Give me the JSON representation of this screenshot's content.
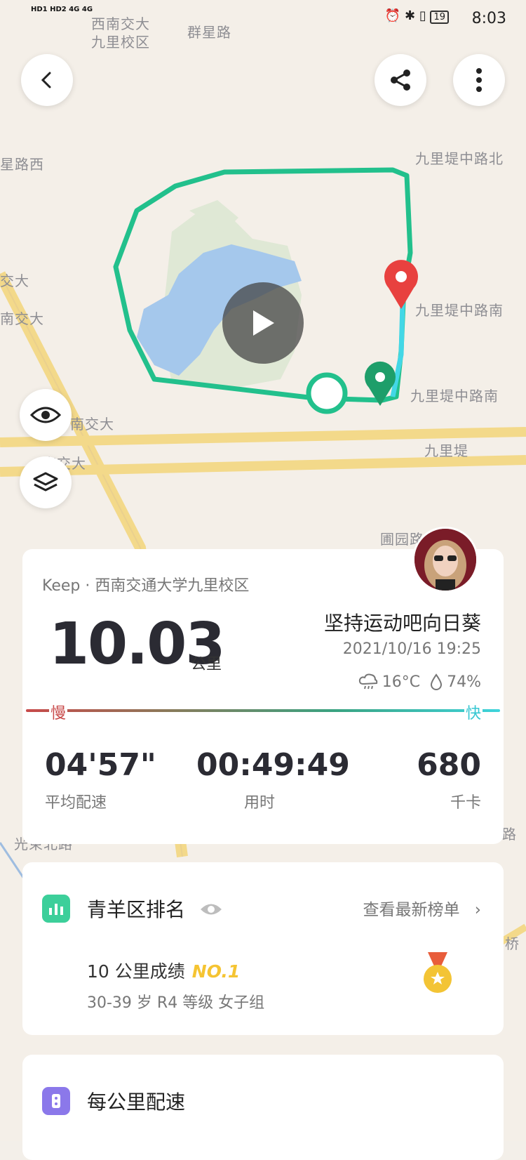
{
  "status_bar": {
    "left_indicators": "HD1 HD2 4G 4G",
    "time": "8:03",
    "battery": "19"
  },
  "map": {
    "labels": [
      "西南交大",
      "九里校区",
      "群星路",
      "九里堤中路北",
      "星路西",
      "交大",
      "南交大",
      "九里堤中路南",
      "九里堤中路南",
      "南交大",
      "南交大",
      "九里堤",
      "圃园路",
      "光束北路",
      "路",
      "桥"
    ],
    "start_color": "#1e9e6a",
    "end_color": "#e8413f",
    "route_color": "#22c08c"
  },
  "summary": {
    "source": "Keep · 西南交通大学九里校区",
    "distance": "10.03",
    "distance_unit": "公里",
    "username": "坚持运动吧向日葵",
    "datetime": "2021/10/16 19:25",
    "temperature": "16°C",
    "humidity": "74%",
    "speed_slow_label": "慢",
    "speed_fast_label": "快",
    "stats": [
      {
        "value": "04'57\"",
        "label": "平均配速"
      },
      {
        "value": "00:49:49",
        "label": "用时"
      },
      {
        "value": "680",
        "label": "千卡"
      }
    ]
  },
  "ranking": {
    "title": "青羊区排名",
    "link": "查看最新榜单",
    "result_label": "10 公里成绩",
    "rank_badge": "NO.1",
    "category": "30-39 岁 R4 等级 女子组",
    "icon_color": "#3ccf9a",
    "medal_color": "#f3c435"
  },
  "pace": {
    "title": "每公里配速",
    "icon_color": "#8b78ea"
  }
}
